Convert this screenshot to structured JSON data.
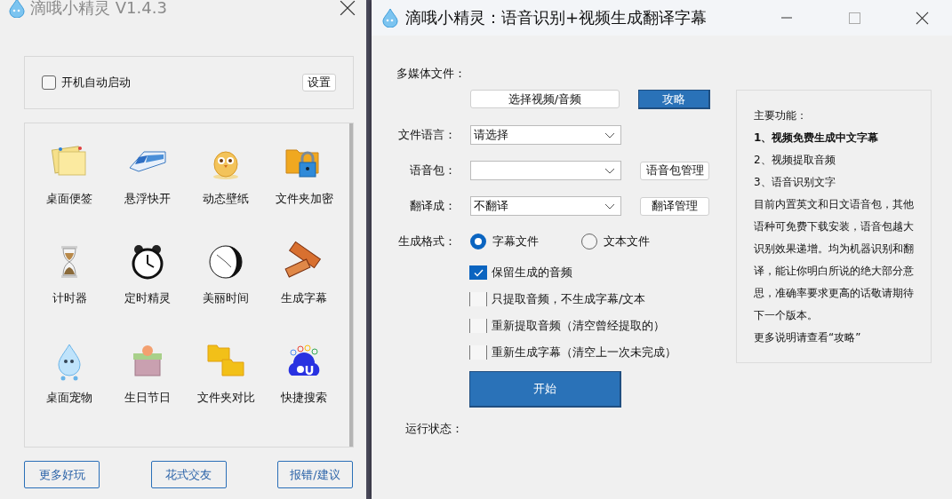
{
  "left_window": {
    "title": "滴哦小精灵 V1.4.3",
    "autostart": {
      "label": "开机自动启动",
      "checked": false
    },
    "settings_button": "设置",
    "tools": [
      {
        "label": "桌面便签"
      },
      {
        "label": "悬浮快开"
      },
      {
        "label": "动态壁纸"
      },
      {
        "label": "文件夹加密"
      },
      {
        "label": "计时器"
      },
      {
        "label": "定时精灵"
      },
      {
        "label": "美丽时间"
      },
      {
        "label": "生成字幕"
      },
      {
        "label": "桌面宠物"
      },
      {
        "label": "生日节日"
      },
      {
        "label": "文件夹对比"
      },
      {
        "label": "快捷搜索"
      }
    ],
    "buttons": [
      "更多好玩",
      "花式交友",
      "报错/建议"
    ]
  },
  "right_window": {
    "title": "滴哦小精灵：语音识别+视频生成翻译字幕",
    "media_label": "多媒体文件：",
    "select_button": "选择视频/音频",
    "guide_button": "攻略",
    "rows": [
      {
        "label": "文件语言：",
        "value": "请选择"
      },
      {
        "label": "语音包：",
        "button": "语音包管理"
      },
      {
        "label": "翻译成：",
        "value": "不翻译",
        "button": "翻译管理"
      }
    ],
    "format": {
      "label": "生成格式：",
      "options": [
        {
          "label": "字幕文件",
          "selected": true
        },
        {
          "label": "文本文件",
          "selected": false
        }
      ]
    },
    "checkboxes": [
      {
        "label": "保留生成的音频",
        "checked": true
      },
      {
        "label": "只提取音频，不生成字幕/文本",
        "checked": false
      },
      {
        "label": "重新提取音频（清空曾经提取的）",
        "checked": false
      },
      {
        "label": "重新生成字幕（清空上一次未完成）",
        "checked": false
      }
    ],
    "start_button": "开始",
    "status_label": "运行状态：",
    "info": [
      {
        "text": "主要功能：",
        "bold": false
      },
      {
        "text": "1、视频免费生成中文字幕",
        "bold": true
      },
      {
        "text": "2、视频提取音频",
        "bold": false
      },
      {
        "text": "3、语音识别文字",
        "bold": false
      },
      {
        "text": "目前内置英文和日文语音包，其他语种可免费下载安装，语音包越大识别效果递增。均为机器识别和翻译，能让你明白所说的绝大部分意思，准确率要求更高的话敬请期待下一个版本。",
        "bold": false
      },
      {
        "text": "更多说明请查看“攻略”",
        "bold": false
      }
    ]
  }
}
